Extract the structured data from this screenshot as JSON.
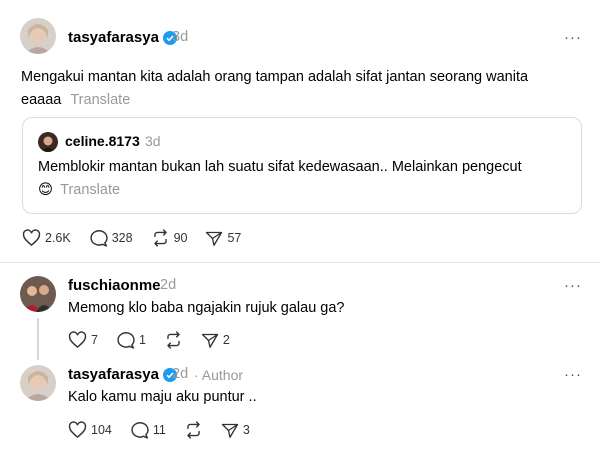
{
  "post": {
    "username": "tasyafarasya",
    "time": "3d",
    "more": "···",
    "text": "Mengakui mantan kita adalah orang tampan adalah sifat jantan seorang wanita eaaaa",
    "translate": "Translate",
    "quote": {
      "username": "celine.8173",
      "time": "3d",
      "text": "Memblokir mantan bukan lah suatu sifat kedewasaan.. Melainkan pengecut",
      "emoji": "😊",
      "translate": "Translate"
    },
    "stats": {
      "likes": "2.6K",
      "replies": "328",
      "reposts": "90",
      "shares": "57"
    }
  },
  "reply1": {
    "username": "fuschiaonme",
    "time": "2d",
    "more": "···",
    "text": "Memong klo baba ngajakin rujuk galau ga?",
    "stats": {
      "likes": "7",
      "replies": "1",
      "shares": "2"
    }
  },
  "reply2": {
    "username": "tasyafarasya",
    "time": "2d",
    "author_tag": "· Author",
    "more": "···",
    "text": "Kalo kamu maju aku puntur ..",
    "stats": {
      "likes": "104",
      "replies": "11",
      "shares": "3"
    }
  },
  "colors": {
    "verified": "#1d9bf0",
    "muted": "#999999",
    "divider": "#e4e4e4"
  }
}
